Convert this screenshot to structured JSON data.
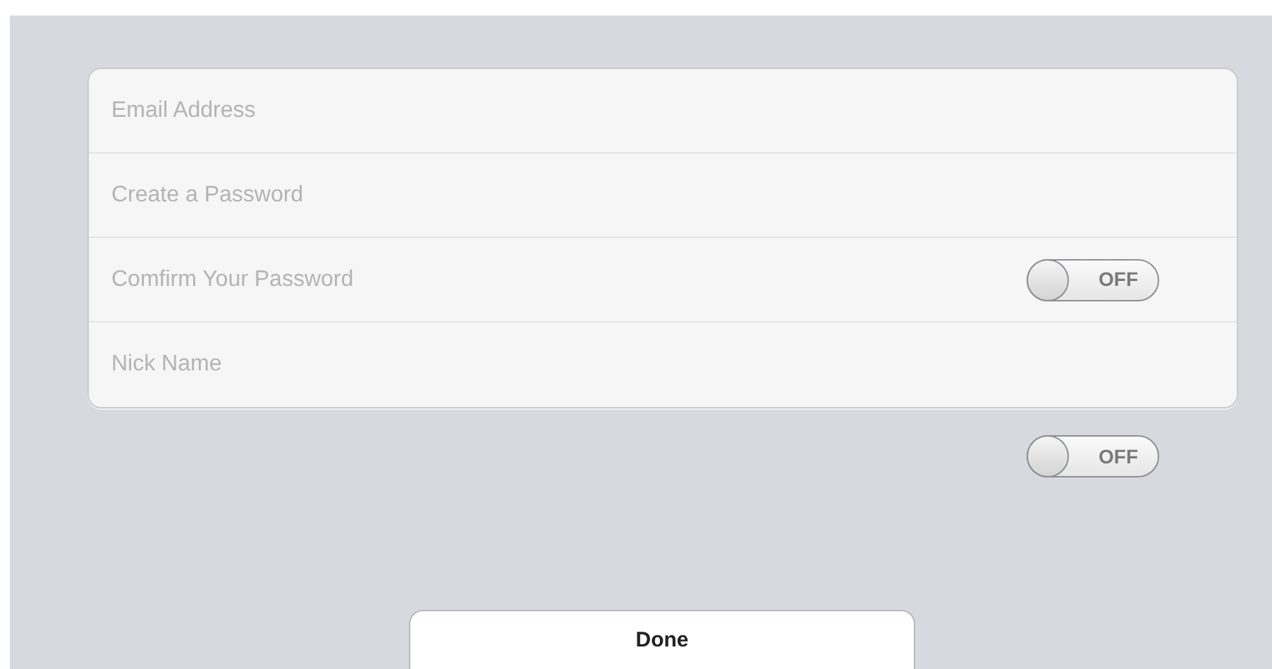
{
  "form": {
    "fields": [
      {
        "placeholder": "Email Address"
      },
      {
        "placeholder": "Create a Password"
      },
      {
        "placeholder": "Comfirm Your Password",
        "toggle": {
          "label": "OFF",
          "on": false
        }
      },
      {
        "placeholder": "Nick Name"
      }
    ]
  },
  "toggle": {
    "label": "OFF",
    "on": false
  },
  "done_button": {
    "label": "Done"
  }
}
